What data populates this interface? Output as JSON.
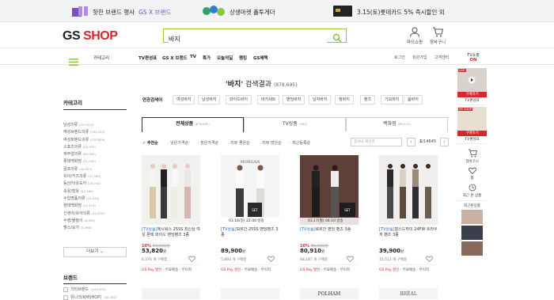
{
  "banner": {
    "items": [
      {
        "text": "핫한 브랜드 행사",
        "accent": "GS X 브랜드",
        "icon": "gift-icon"
      },
      {
        "text": "상생마켓 폴투게더",
        "icon": "leaf-logo-icon"
      },
      {
        "text": "3.15(토)롯데카드 5% 즉시할인 외",
        "icon": "card-icon"
      }
    ]
  },
  "header": {
    "logo_gs": "GS",
    "logo_shop": " SHOP",
    "search_value": "바지",
    "mypage_label": "마이쇼핑",
    "cart_label": "장바구니"
  },
  "nav": {
    "category_label": "카테고리",
    "menu": [
      "TV편성표",
      "GS X 브랜드",
      "TV",
      "특가",
      "오늘의딜",
      "랭킹",
      "GS혜택"
    ],
    "util": [
      "로그인",
      "회원가입",
      "고객센터"
    ],
    "tvlive_label": "TV쇼핑",
    "tvlive_status": "ON"
  },
  "result": {
    "query": "'바지'",
    "label": " 검색결과",
    "count": "(878,695)"
  },
  "related": {
    "label": "연관검색어",
    "chips": [
      "여성바지",
      "남성바지",
      "와이드바지",
      "바지세트",
      "밴딩바지",
      "남자바지",
      "청바지",
      "팬츠",
      "기모바지",
      "봄바지"
    ]
  },
  "tabs": [
    {
      "label": "전체상품",
      "count": "(878,695)"
    },
    {
      "label": "TV상품",
      "count": "(361)"
    },
    {
      "label": "백화점",
      "count": "(69,974)"
    }
  ],
  "sorts": [
    "추천순",
    "낮은가격순",
    "높은가격순",
    "리뷰 좋은순",
    "리뷰 많은순",
    "최근등록순"
  ],
  "filter_placeholder": "결과내 재검색",
  "pagination": {
    "current": "1",
    "total": "/14645"
  },
  "sidebar": {
    "title": "카테고리",
    "items": [
      {
        "name": "남성의류",
        "count": "(223,023)"
      },
      {
        "name": "여성브랜드의류",
        "count": "(195,253)"
      },
      {
        "name": "여성트렌드의류",
        "count": "(120,839)"
      },
      {
        "name": "스포츠의류",
        "count": "(94,795)"
      },
      {
        "name": "캐주얼의류",
        "count": "(60,365)"
      },
      {
        "name": "롯데백화점",
        "count": "(51,295)"
      },
      {
        "name": "골프의류",
        "count": "(44,923)"
      },
      {
        "name": "유아/키즈의류",
        "count": "(43,393)"
      },
      {
        "name": "등산/아웃도어",
        "count": "(25,204)"
      },
      {
        "name": "속옷/잠옷",
        "count": "(22,289)"
      },
      {
        "name": "수입명품의류",
        "count": "(20,529)"
      },
      {
        "name": "현대백화점",
        "count": "(15,443)"
      },
      {
        "name": "신생아/유아의류",
        "count": "(12,240)"
      },
      {
        "name": "수영/물놀이",
        "count": "(6,890)"
      },
      {
        "name": "헬스/요가",
        "count": "(5,360)"
      }
    ],
    "more_label": "더보기",
    "brand_title": "브랜드",
    "brands": [
      "기타브랜드",
      "뮤니크(KMSHOP)"
    ],
    "brand_counts": [
      "(108,303)",
      "(40,381)"
    ]
  },
  "products": [
    {
      "title_tag": "[TV상품]",
      "title": "에시워스 25SS 최신상 여성 론테 와이드 밴딩팬츠 3종",
      "disc": "10%",
      "orig": "59,900원",
      "price": "53,820",
      "unit": "원",
      "buy": "6,576 개 구매중",
      "pay": "GS Pay 할인",
      "ship": "· 무료배송 · 무이자",
      "stamp": ""
    },
    {
      "title_tag": "[TV상품]",
      "title": "모르간 25SS 밴딩팬츠 3종",
      "disc": "",
      "orig": "",
      "price": "89,900",
      "unit": "원",
      "buy": "5,893 개 구매중",
      "pay": "GS Pay 할인",
      "ship": "· 무료배송 · 무이자",
      "stamp": "03.16(일) 22:40 방송"
    },
    {
      "title_tag": "[TV상품]",
      "title": "로르간 밴딩 팬츠 3종",
      "disc": "10%",
      "orig": "89,900원",
      "price": "80,910",
      "unit": "원",
      "buy": "48,187 개 구매중",
      "pay": "GS Pay 할인",
      "ship": "· 무료배송 · 무이자",
      "stamp": "03.17(월) 04:10 방송"
    },
    {
      "title_tag": "[TV상품]",
      "title": "찰스드뷔이 24FW 트라우저 팬츠 3종",
      "disc": "",
      "orig": "",
      "price": "39,900",
      "unit": "원",
      "buy": "15,513 개 구매중",
      "pay": "GS Pay 할인",
      "ship": "· 무료배송 · 무이자",
      "stamp": ""
    }
  ],
  "second_row_brands": [
    "",
    "",
    "POLHAM",
    "BRÉAL"
  ],
  "rpanel": {
    "live_label": "LIVE",
    "live_btn": "구매하기",
    "live_sub": "TV편성표",
    "myshop_label": "MY SHOP",
    "myshop_btn": "구매하기",
    "myshop_sub": "TV편성표",
    "cart_label": "장바구니",
    "wish_label": "찜",
    "recent_label": "최근 본 상품",
    "recent_title": "최근본상품"
  },
  "colors": {
    "brand_red": "#d9262c",
    "search_green": "#9cc93a",
    "tv_blue": "#2a6fc2"
  }
}
